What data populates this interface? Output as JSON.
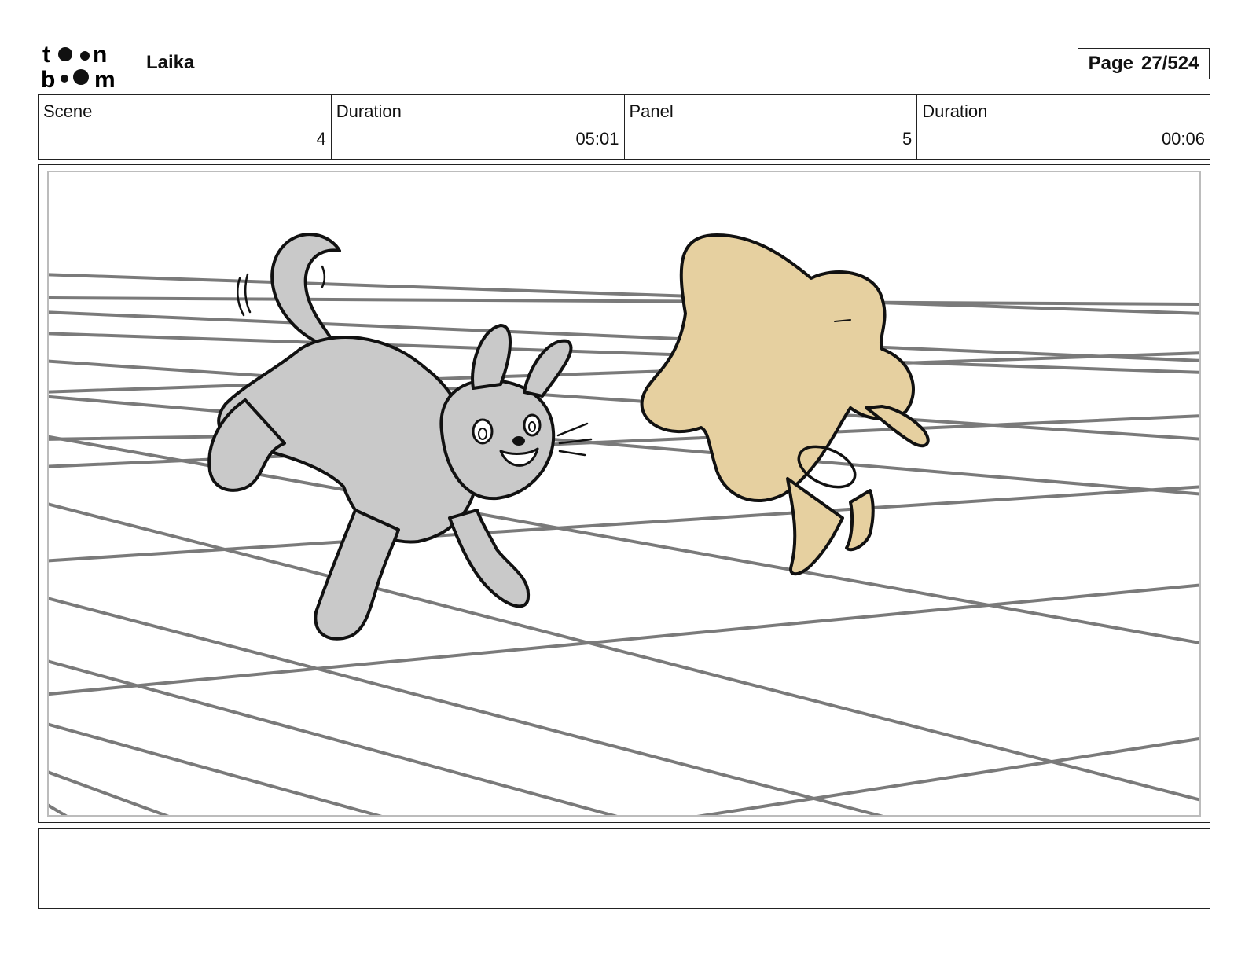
{
  "header": {
    "logo_text": "toon boom",
    "project_title": "Laika",
    "page_label": "Page",
    "page_number": "27/524"
  },
  "info": {
    "scene_label": "Scene",
    "scene_value": "4",
    "scene_duration_label": "Duration",
    "scene_duration_value": "05:01",
    "panel_label": "Panel",
    "panel_value": "5",
    "panel_duration_label": "Duration",
    "panel_duration_value": "00:06"
  },
  "colors": {
    "dog_fill": "#c9c9c9",
    "blob_fill": "#e6d0a0",
    "grid_line": "#7a7a7a",
    "ink": "#111111"
  },
  "notes": {
    "text": ""
  }
}
